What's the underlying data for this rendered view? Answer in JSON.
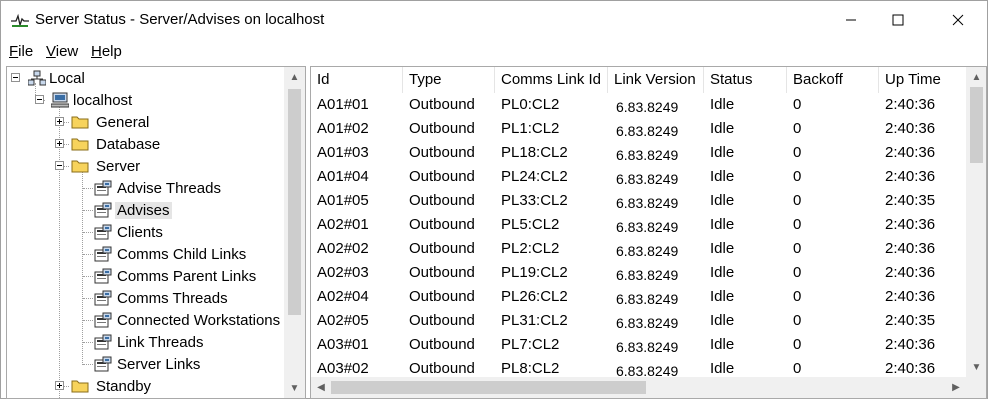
{
  "window": {
    "title": "Server Status - Server/Advises on localhost"
  },
  "menu": [
    "File",
    "View",
    "Help"
  ],
  "tree": {
    "root": "Local",
    "host": "localhost",
    "folders_top": [
      "General",
      "Database",
      "Server"
    ],
    "server_items": [
      "Advise Threads",
      "Advises",
      "Clients",
      "Comms Child Links",
      "Comms Parent Links",
      "Comms Threads",
      "Connected Workstations",
      "Link Threads",
      "Server Links"
    ],
    "selected": "Advises",
    "folders_bottom": [
      "Standby"
    ]
  },
  "table": {
    "columns": [
      "Id",
      "Type",
      "Comms Link Id",
      "Link Version",
      "Status",
      "Backoff",
      "Up Time"
    ],
    "rows": [
      [
        "A01#01",
        "Outbound",
        "PL0:CL2",
        "6.83.8249",
        "Idle",
        "0",
        "2:40:36"
      ],
      [
        "A01#02",
        "Outbound",
        "PL1:CL2",
        "6.83.8249",
        "Idle",
        "0",
        "2:40:36"
      ],
      [
        "A01#03",
        "Outbound",
        "PL18:CL2",
        "6.83.8249",
        "Idle",
        "0",
        "2:40:36"
      ],
      [
        "A01#04",
        "Outbound",
        "PL24:CL2",
        "6.83.8249",
        "Idle",
        "0",
        "2:40:36"
      ],
      [
        "A01#05",
        "Outbound",
        "PL33:CL2",
        "6.83.8249",
        "Idle",
        "0",
        "2:40:35"
      ],
      [
        "A02#01",
        "Outbound",
        "PL5:CL2",
        "6.83.8249",
        "Idle",
        "0",
        "2:40:36"
      ],
      [
        "A02#02",
        "Outbound",
        "PL2:CL2",
        "6.83.8249",
        "Idle",
        "0",
        "2:40:36"
      ],
      [
        "A02#03",
        "Outbound",
        "PL19:CL2",
        "6.83.8249",
        "Idle",
        "0",
        "2:40:36"
      ],
      [
        "A02#04",
        "Outbound",
        "PL26:CL2",
        "6.83.8249",
        "Idle",
        "0",
        "2:40:36"
      ],
      [
        "A02#05",
        "Outbound",
        "PL31:CL2",
        "6.83.8249",
        "Idle",
        "0",
        "2:40:35"
      ],
      [
        "A03#01",
        "Outbound",
        "PL7:CL2",
        "6.83.8249",
        "Idle",
        "0",
        "2:40:36"
      ],
      [
        "A03#02",
        "Outbound",
        "PL8:CL2",
        "6.83.8249",
        "Idle",
        "0",
        "2:40:36"
      ]
    ]
  },
  "icons": {
    "app": "server-status-icon",
    "root": "network-icon",
    "host": "computer-icon",
    "folder": "folder-icon",
    "item": "status-page-icon"
  },
  "colors": {
    "app_icon_green": "#2a8a2a",
    "folder_yellow": "#f7d35c",
    "selection": "#e5e5e5"
  }
}
